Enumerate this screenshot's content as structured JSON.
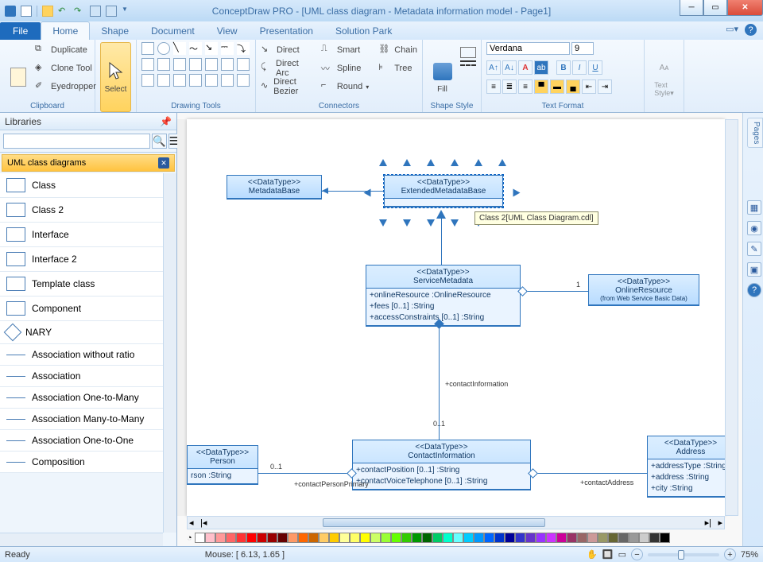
{
  "window": {
    "title": "ConceptDraw PRO - [UML class diagram - Metadata information model - Page1]"
  },
  "tabs": {
    "file": "File",
    "items": [
      "Home",
      "Shape",
      "Document",
      "View",
      "Presentation",
      "Solution Park"
    ],
    "active": 0
  },
  "ribbon": {
    "clipboard": {
      "label": "Clipboard",
      "duplicate": "Duplicate",
      "clone": "Clone Tool",
      "eyedropper": "Eyedropper"
    },
    "select": {
      "label": "Select"
    },
    "drawing": {
      "label": "Drawing Tools"
    },
    "connectors": {
      "label": "Connectors",
      "direct": "Direct",
      "directarc": "Direct Arc",
      "directbezier": "Direct Bezier",
      "smart": "Smart",
      "spline": "Spline",
      "round": "Round",
      "chain": "Chain",
      "tree": "Tree"
    },
    "fill": {
      "label": "Fill"
    },
    "shapestyle": {
      "label": "Shape Style"
    },
    "textformat": {
      "label": "Text Format",
      "font": "Verdana",
      "size": "9"
    },
    "textstyle": {
      "label": "Text Style"
    }
  },
  "libraries": {
    "header": "Libraries",
    "title": "UML class diagrams",
    "items": [
      "Class",
      "Class 2",
      "Interface",
      "Interface 2",
      "Template class",
      "Component",
      "NARY",
      "Association without ratio",
      "Association",
      "Association One-to-Many",
      "Association Many-to-Many",
      "Association One-to-One",
      "Composition"
    ]
  },
  "canvas": {
    "tooltip": "Class 2[UML Class Diagram.cdl]",
    "boxes": {
      "metadatabase": {
        "stereo": "<<DataType>>",
        "name": "MetadataBase"
      },
      "extended": {
        "stereo": "<<DataType>>",
        "name": "ExtendedMetadataBase"
      },
      "service": {
        "stereo": "<<DataType>>",
        "name": "ServiceMetadata",
        "attrs": "+onlineResource :OnlineResource\n+fees [0..1] :String\n+accessConstraints [0..1] :String"
      },
      "online": {
        "stereo": "<<DataType>>",
        "name": "OnlineResource",
        "from": "(from Web Service Basic Data)"
      },
      "contact": {
        "stereo": "<<DataType>>",
        "name": "ContactInformation",
        "attrs": "+contactPosition [0..1] :String\n+contactVoiceTelephone [0..1] :String"
      },
      "person": {
        "stereo": "<<DataType>>",
        "name": "Person",
        "attrs": "rson :String"
      },
      "address": {
        "stereo": "<<DataType>>",
        "name": "Address",
        "attrs": "+addressType :String\n+address :String\n+city :String"
      }
    },
    "labels": {
      "contactinfo": "+contactInformation",
      "mult01": "0..1",
      "one": "1",
      "contactperson": "+contactPersonPrimary",
      "contactaddress": "+contactAddress"
    }
  },
  "pages": {
    "tab": "Pages"
  },
  "status": {
    "ready": "Ready",
    "mouse": "Mouse: [ 6.13, 1.65 ]",
    "zoom": "75%"
  },
  "colorbar": [
    "#ffffff",
    "#ffc0cb",
    "#ff9999",
    "#ff6666",
    "#ff3333",
    "#ff0000",
    "#cc0000",
    "#990000",
    "#660000",
    "#ff9966",
    "#ff6600",
    "#cc6600",
    "#ffcc66",
    "#ffcc00",
    "#ffff99",
    "#ffff66",
    "#ffff00",
    "#ccff66",
    "#99ff33",
    "#66ff00",
    "#33cc00",
    "#009900",
    "#006600",
    "#00cc66",
    "#00ffcc",
    "#66ffff",
    "#00ccff",
    "#0099ff",
    "#0066ff",
    "#0033cc",
    "#000099",
    "#3333cc",
    "#6633cc",
    "#9933ff",
    "#cc33ff",
    "#cc0099",
    "#993366",
    "#996666",
    "#cc9999",
    "#999966",
    "#666633",
    "#666666",
    "#999999",
    "#cccccc",
    "#333333",
    "#000000"
  ]
}
